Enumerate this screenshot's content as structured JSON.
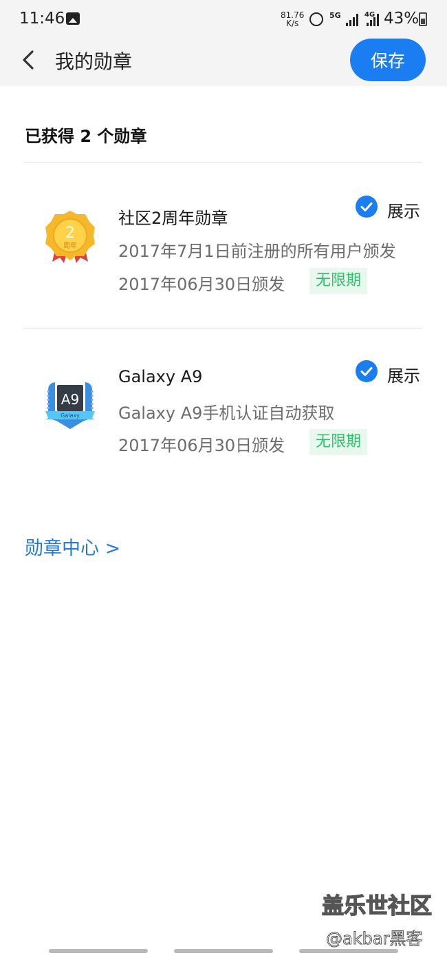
{
  "status_bar": {
    "time": "11:46",
    "speed_value": "81.76",
    "speed_unit": "K/s",
    "network_5g": "5G",
    "network_4g": "4G",
    "battery": "43%"
  },
  "app_bar": {
    "title": "我的勋章",
    "save_label": "保存"
  },
  "summary": {
    "earned_text": "已获得 2 个勋章"
  },
  "badges": [
    {
      "icon_text": "2",
      "icon_sub": "周年",
      "name": "社区2周年勋章",
      "description": "2017年7月1日前注册的所有用户颁发",
      "date": "2017年06月30日颁发",
      "tag": "无限期",
      "show_label": "展示",
      "shown": true
    },
    {
      "icon_text": "A9",
      "icon_sub": "Galaxy",
      "name": "Galaxy A9",
      "description": "Galaxy A9手机认证自动获取",
      "date": "2017年06月30日颁发",
      "tag": "无限期",
      "show_label": "展示",
      "shown": true
    }
  ],
  "badge_center_link": "勋章中心 >",
  "watermark": {
    "title": "盖乐世社区",
    "user": "@akbar黑客"
  },
  "colors": {
    "accent": "#1a7df2",
    "link": "#1f7ad8",
    "tag_text": "#2fbf6e",
    "tag_bg": "#e8f8ef"
  }
}
